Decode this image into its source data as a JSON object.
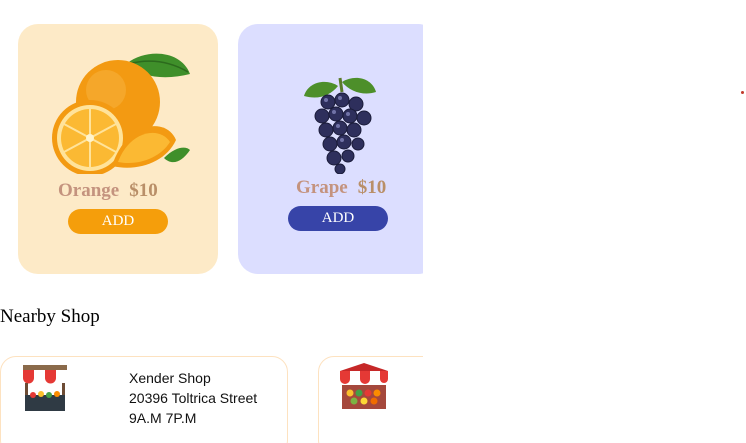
{
  "products": [
    {
      "name": "Orange",
      "price": "$10",
      "button": "ADD",
      "icon": "orange-icon",
      "accent": "#f59e0b"
    },
    {
      "name": "Grape",
      "price": "$10",
      "button": "ADD",
      "icon": "grape-icon",
      "accent": "#3744a8"
    }
  ],
  "nearby": {
    "title": "Nearby Shop",
    "shops": [
      {
        "name": "Xender Shop",
        "address": "20396 Toltrica Street",
        "hours": "9A.M  7P.M",
        "icon": "shop-stall-icon"
      },
      {
        "icon": "shop-stall-icon"
      }
    ]
  }
}
